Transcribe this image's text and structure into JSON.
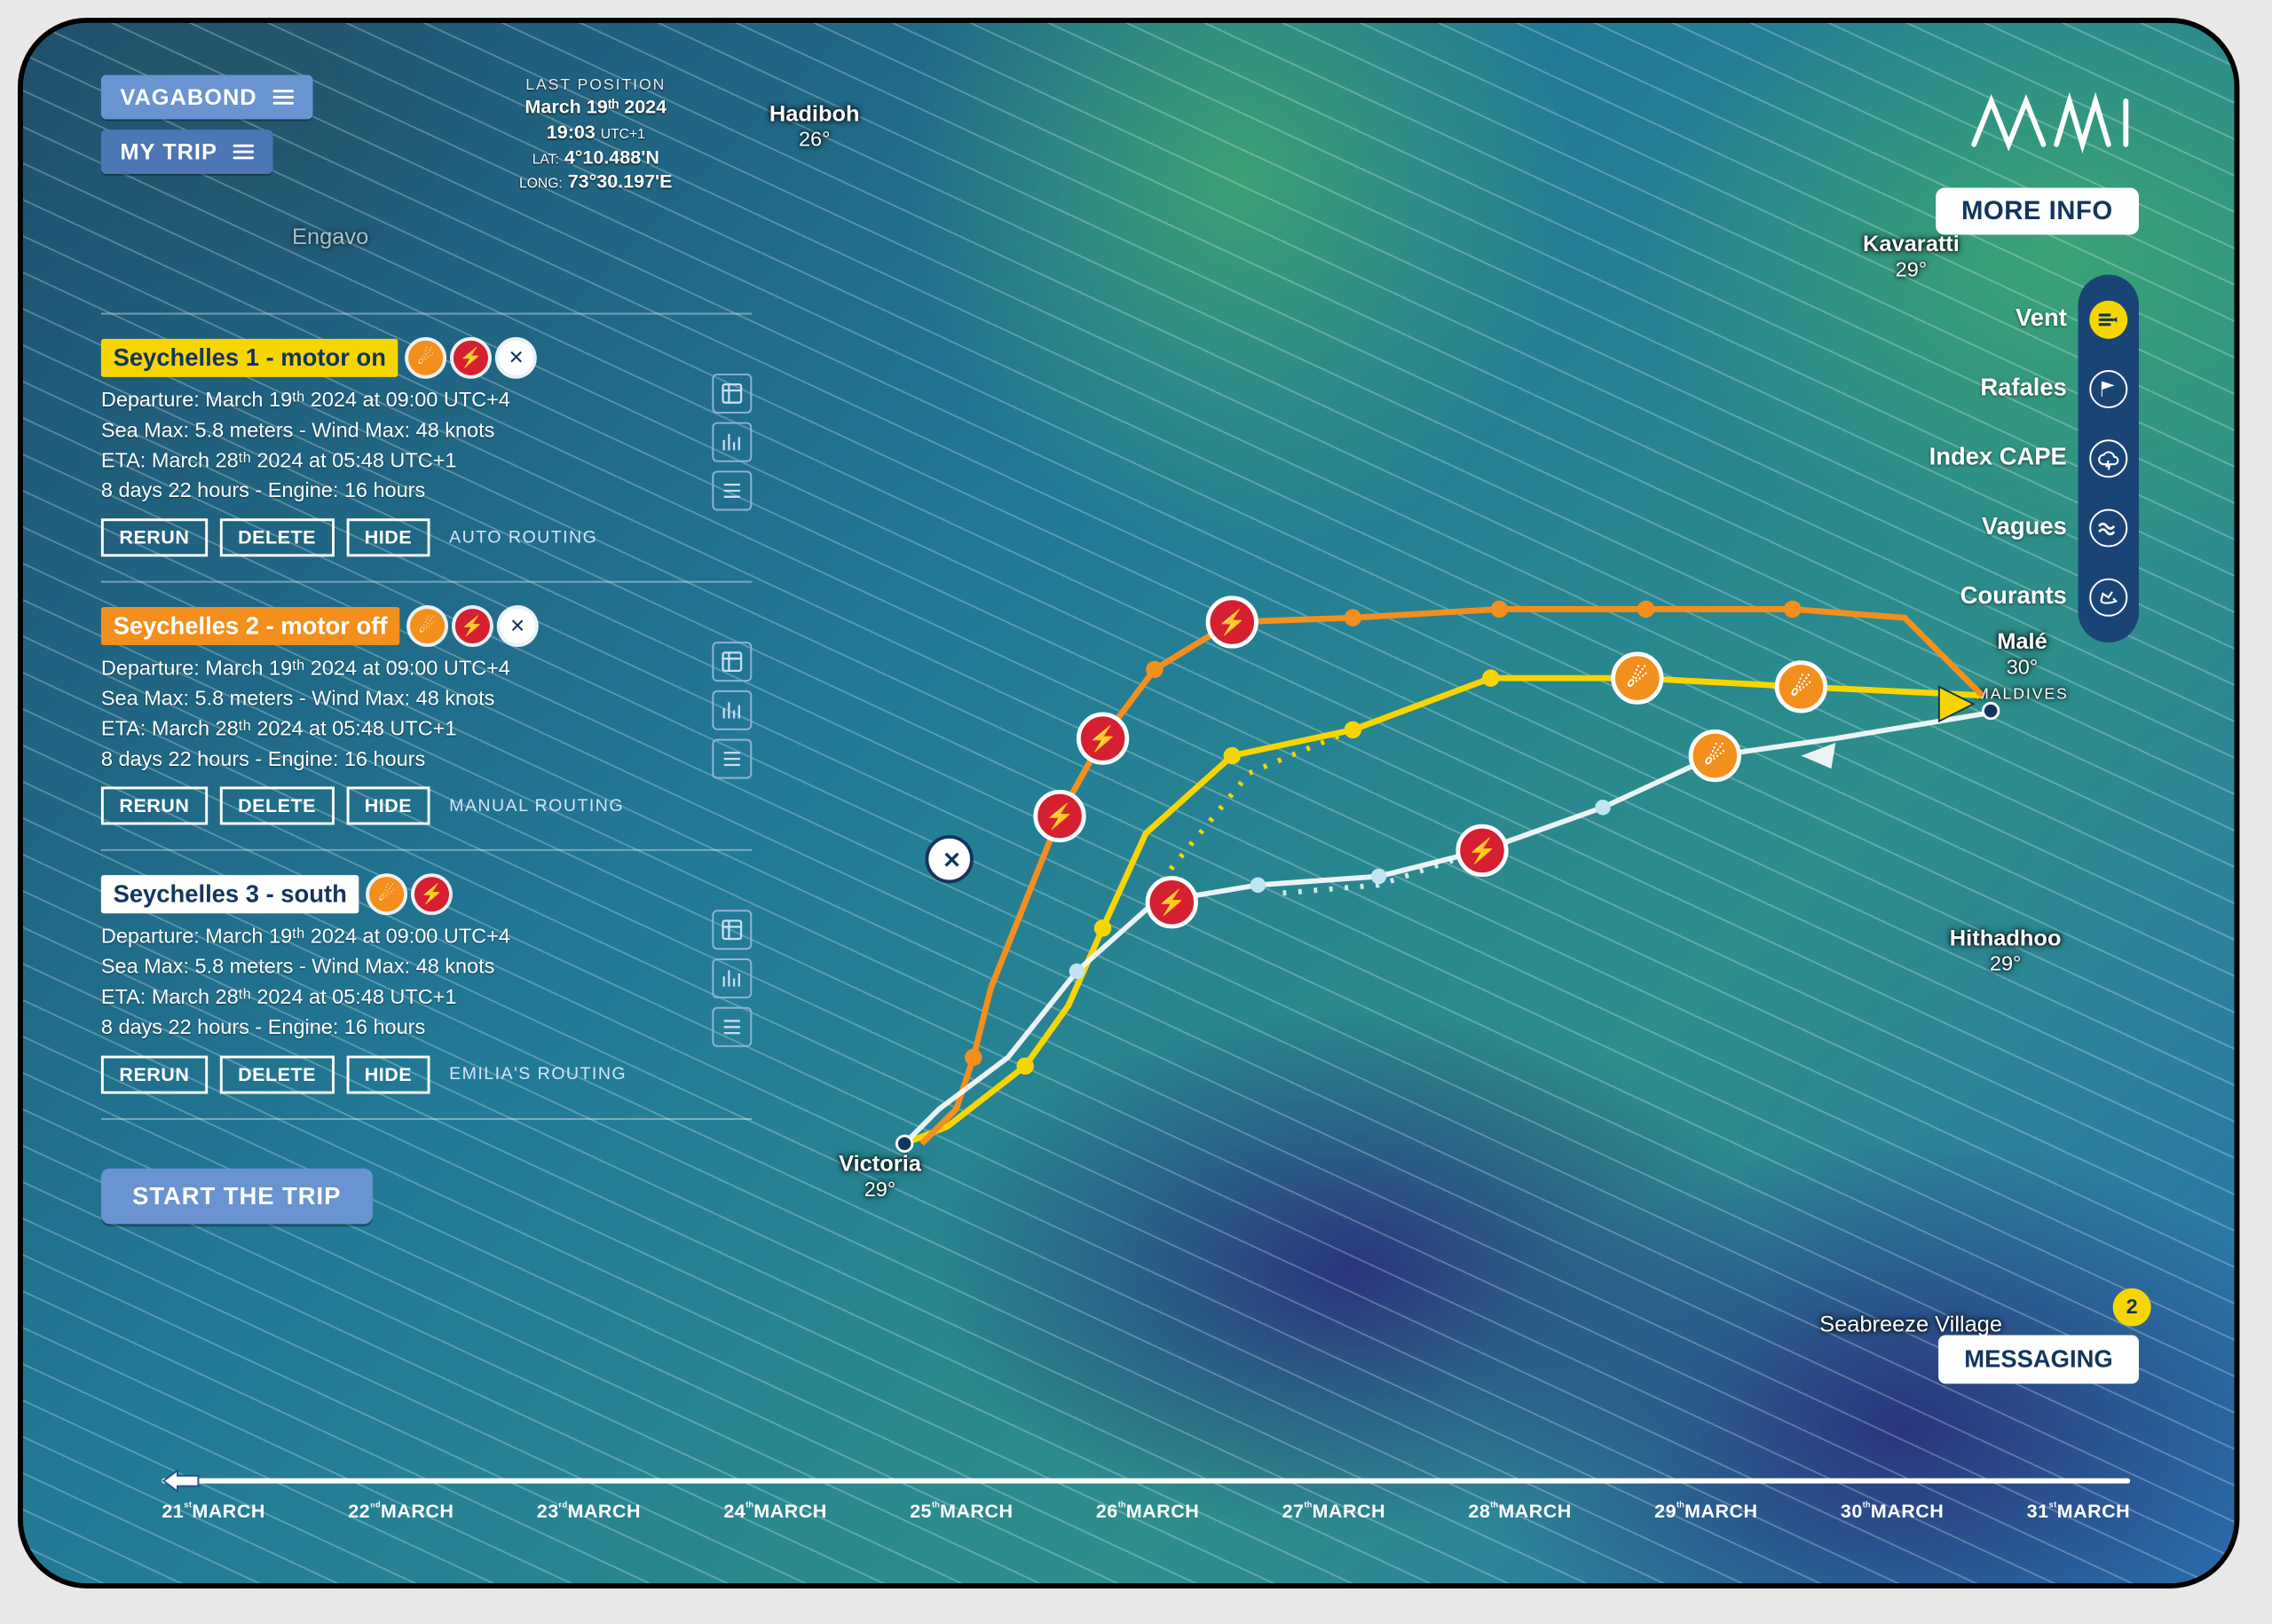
{
  "header": {
    "boat_button": "VAGABOND",
    "trip_button": "MY TRIP",
    "last_position_label": "LAST POSITION",
    "date": "March 19ᵗʰ 2024",
    "time": "19:03",
    "tz": "UTC+1",
    "lat_label": "LAT:",
    "lat": "4°10.488'N",
    "long_label": "LONG:",
    "long": "73°30.197'E"
  },
  "routes": [
    {
      "title": "Seychelles 1 - motor on",
      "title_class": "tp1",
      "departure": "Departure: March 19ᵗʰ 2024 at 09:00 UTC+4",
      "seamax": "Sea Max: 5.8 meters - Wind Max: 48 knots",
      "eta": "ETA: March 28ᵗʰ 2024 at 05:48 UTC+1",
      "duration": "8 days 22 hours - Engine: 16 hours",
      "routing_note": "AUTO ROUTING",
      "badges": [
        "ora",
        "red",
        "wht"
      ]
    },
    {
      "title": "Seychelles 2 - motor off",
      "title_class": "tp2",
      "departure": "Departure: March 19ᵗʰ 2024 at 09:00 UTC+4",
      "seamax": "Sea Max: 5.8 meters - Wind Max: 48 knots",
      "eta": "ETA: March 28ᵗʰ 2024 at 05:48 UTC+1",
      "duration": "8 days 22 hours - Engine: 16 hours",
      "routing_note": "MANUAL ROUTING",
      "badges": [
        "ora",
        "red",
        "wht"
      ]
    },
    {
      "title": "Seychelles 3 - south",
      "title_class": "tp3",
      "departure": "Departure: March 19ᵗʰ 2024 at 09:00 UTC+4",
      "seamax": "Sea Max: 5.8 meters - Wind Max: 48 knots",
      "eta": "ETA: March 28ᵗʰ 2024 at 05:48 UTC+1",
      "duration": "8 days 22 hours - Engine: 16 hours",
      "routing_note": "EMILIA'S ROUTING",
      "badges": [
        "ora",
        "red"
      ]
    }
  ],
  "buttons": {
    "rerun": "RERUN",
    "delete": "DELETE",
    "hide": "HIDE",
    "start": "START THE TRIP",
    "more_info": "MORE INFO",
    "messaging": "MESSAGING"
  },
  "logo": "MWI",
  "msg_count": "2",
  "layers": [
    {
      "label": "Vent",
      "active": true
    },
    {
      "label": "Rafales",
      "active": false
    },
    {
      "label": "Index CAPE",
      "active": false
    },
    {
      "label": "Vagues",
      "active": false
    },
    {
      "label": "Courants",
      "active": false
    }
  ],
  "map_labels": {
    "hadiboh": "Hadiboh",
    "hadiboh_t": "26°",
    "kavaratti": "Kavaratti",
    "kavaratti_t": "29°",
    "male": "Malé",
    "male_t": "30°",
    "male_sub": "MALDIVES",
    "hithadhoo": "Hithadhoo",
    "hithadhoo_t": "29°",
    "victoria": "Victoria",
    "victoria_t": "29°",
    "seabreeze": "Seabreeze Village",
    "engavo": "Engavo"
  },
  "timeline": {
    "ticks": [
      "21ˢᵗMARCH",
      "22ⁿᵈMARCH",
      "23ʳᵈMARCH",
      "24ᵗʰMARCH",
      "25ᵗʰMARCH",
      "26ᵗʰMARCH",
      "27ᵗʰMARCH",
      "28ᵗʰMARCH",
      "29ᵗʰMARCH",
      "30ᵗʰMARCH",
      "31ˢᵗMARCH"
    ]
  }
}
